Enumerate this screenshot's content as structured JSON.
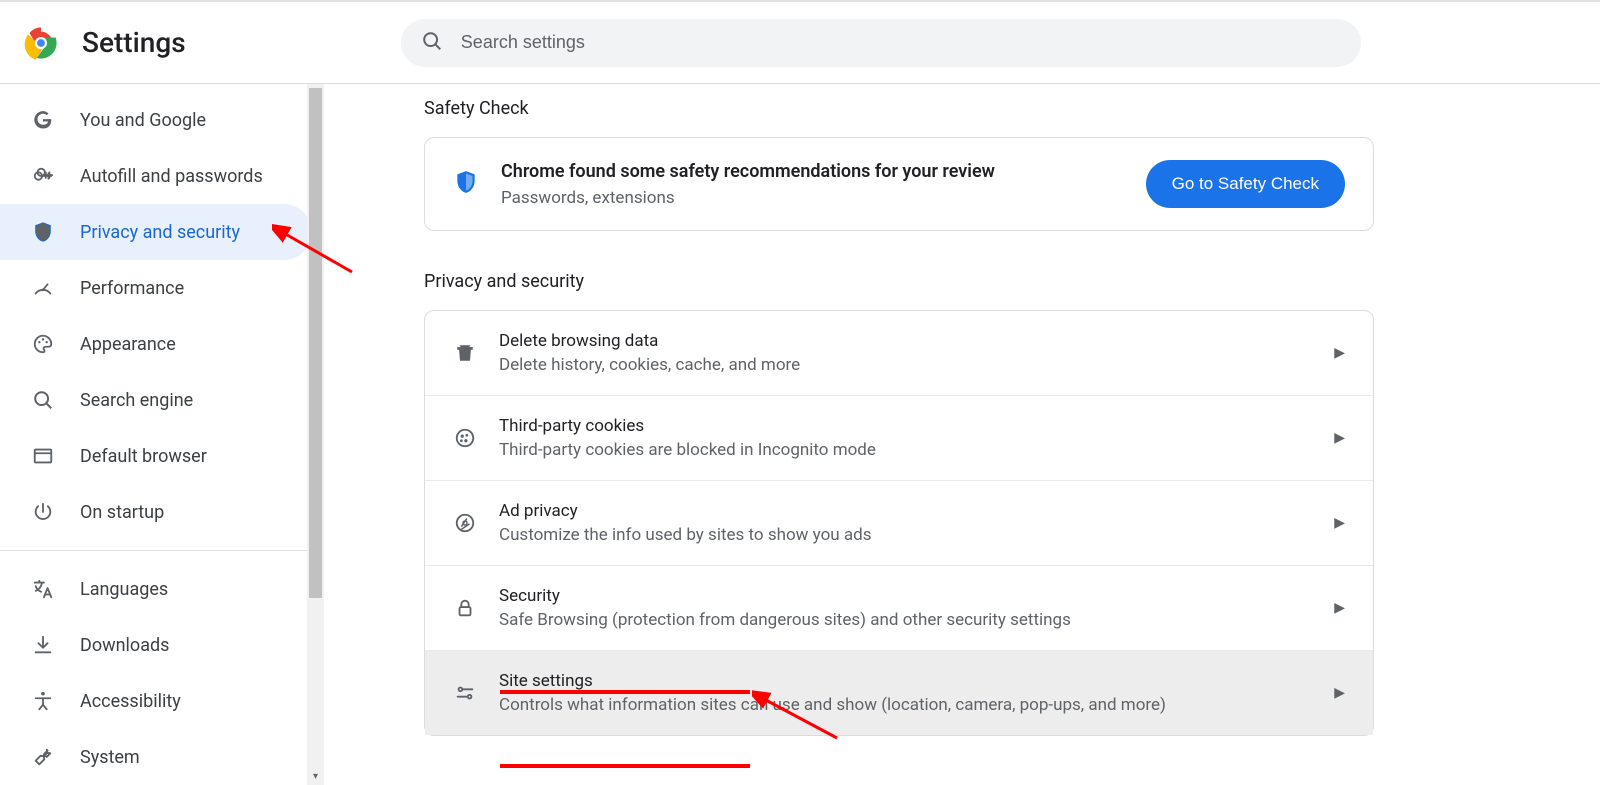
{
  "header": {
    "title": "Settings",
    "search_placeholder": "Search settings"
  },
  "sidebar": {
    "items": [
      {
        "id": "you",
        "label": "You and Google",
        "icon": "google"
      },
      {
        "id": "autofill",
        "label": "Autofill and passwords",
        "icon": "key"
      },
      {
        "id": "privacy",
        "label": "Privacy and security",
        "icon": "shield",
        "active": true
      },
      {
        "id": "performance",
        "label": "Performance",
        "icon": "speed"
      },
      {
        "id": "appearance",
        "label": "Appearance",
        "icon": "palette"
      },
      {
        "id": "search-engine",
        "label": "Search engine",
        "icon": "search"
      },
      {
        "id": "default-browser",
        "label": "Default browser",
        "icon": "browser"
      },
      {
        "id": "startup",
        "label": "On startup",
        "icon": "power"
      },
      {
        "sep": true
      },
      {
        "id": "languages",
        "label": "Languages",
        "icon": "translate"
      },
      {
        "id": "downloads",
        "label": "Downloads",
        "icon": "download"
      },
      {
        "id": "accessibility",
        "label": "Accessibility",
        "icon": "accessibility"
      },
      {
        "id": "system",
        "label": "System",
        "icon": "wrench"
      }
    ]
  },
  "main": {
    "safety_heading": "Safety Check",
    "safety_title": "Chrome found some safety recommendations for your review",
    "safety_sub": "Passwords, extensions",
    "safety_button": "Go to Safety Check",
    "privacy_heading": "Privacy and security",
    "rows": [
      {
        "id": "delete",
        "icon": "trash",
        "title": "Delete browsing data",
        "sub": "Delete history, cookies, cache, and more"
      },
      {
        "id": "cookies",
        "icon": "cookie",
        "title": "Third-party cookies",
        "sub": "Third-party cookies are blocked in Incognito mode"
      },
      {
        "id": "ad-privacy",
        "icon": "ad",
        "title": "Ad privacy",
        "sub": "Customize the info used by sites to show you ads"
      },
      {
        "id": "security",
        "icon": "lock",
        "title": "Security",
        "sub": "Safe Browsing (protection from dangerous sites) and other security settings"
      },
      {
        "id": "site-settings",
        "icon": "sliders",
        "title": "Site settings",
        "sub": "Controls what information sites can use and show (location, camera, pop-ups, and more)",
        "hover": true
      }
    ]
  }
}
